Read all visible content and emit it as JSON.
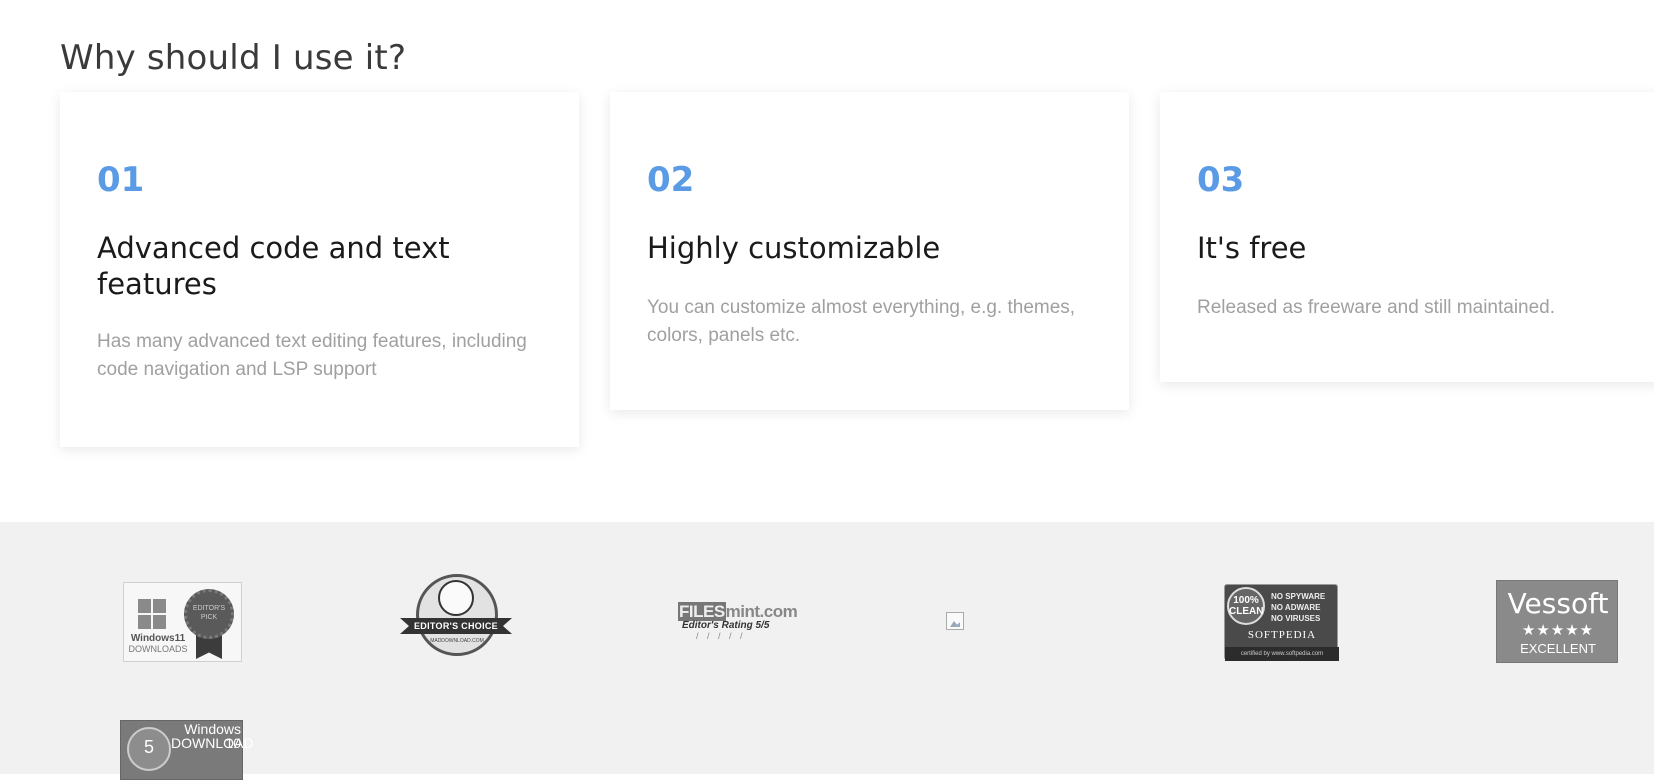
{
  "section": {
    "heading": "Why should I use it?"
  },
  "features": [
    {
      "number": "01",
      "title": "Advanced code and text features",
      "description": "Has many advanced text editing features, including code navigation and LSP support"
    },
    {
      "number": "02",
      "title": "Highly customizable",
      "description": "You can customize almost everything, e.g. themes, colors, panels etc."
    },
    {
      "number": "03",
      "title": "It's free",
      "description": "Released as freeware and still maintained."
    }
  ],
  "colors": {
    "accent": "#5b9be6",
    "heading": "#3a3a3a",
    "description": "#a0a0a0",
    "footer_bg": "#f1f1f1"
  },
  "badges": {
    "windows11": {
      "line1": "Windows11",
      "line2": "DOWNLOADS",
      "seal_text": "EDITOR'S PICK"
    },
    "editors_choice": {
      "label": "EDITOR'S CHOICE",
      "site": "MADDOWNLOAD.COM"
    },
    "filesmint": {
      "logo_a": "FILES",
      "logo_b": "mint.com",
      "rating": "Editor's Rating 5/5"
    },
    "softpedia": {
      "circle": "100% CLEAN",
      "l1": "NO SPYWARE",
      "l2": "NO ADWARE",
      "l3": "NO VIRUSES",
      "brand": "SOFTPEDIA",
      "cert": "certified by www.softpedia.com"
    },
    "vessoft": {
      "name": "Vessoft",
      "stars": "★★★★★",
      "rating": "EXCELLENT"
    },
    "windows10": {
      "rating": "5",
      "line1": "Windows 10",
      "line2": "DOWNLOAD"
    }
  }
}
